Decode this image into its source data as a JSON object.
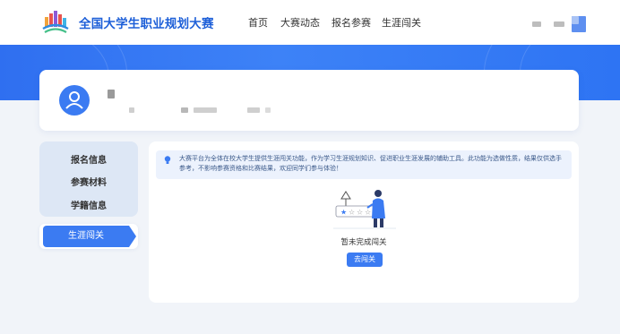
{
  "brand": {
    "title": "全国大学生职业规划大赛"
  },
  "nav": [
    {
      "label": "首页"
    },
    {
      "label": "大赛动态"
    },
    {
      "label": "报名参赛"
    },
    {
      "label": "生涯闯关"
    }
  ],
  "sidebar": {
    "items": [
      {
        "label": "报名信息"
      },
      {
        "label": "参赛材料"
      },
      {
        "label": "学籍信息"
      }
    ],
    "active": {
      "label": "生涯闯关"
    }
  },
  "notice": {
    "text": "大赛平台为全体在校大学生提供生涯闯关功能，作为学习生涯规划知识、促进职业生涯发展的辅助工具。此功能为选做性质，结果仅供选手参考，不影响参赛资格和比赛结果，欢迎同学们参与体验！"
  },
  "empty_state": {
    "text": "暂未完成闯关",
    "button_label": "去闯关"
  },
  "colors": {
    "primary": "#3b7bf2",
    "brand_text": "#1d5fd8",
    "page_bg": "#f1f4f9",
    "side_bg": "#dde7f5",
    "notice_bg": "#ecf2fd"
  }
}
